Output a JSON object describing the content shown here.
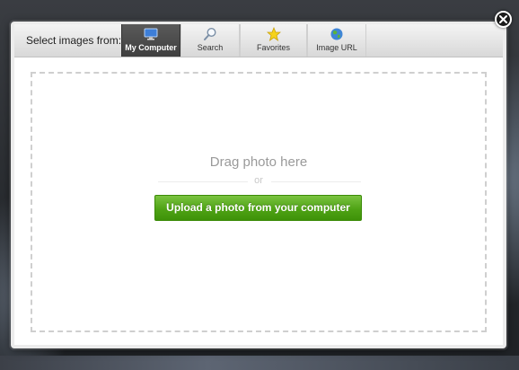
{
  "dialog": {
    "select_label": "Select images from:",
    "tabs": [
      {
        "label": "My Computer",
        "icon": "monitor-icon",
        "active": true
      },
      {
        "label": "Search",
        "icon": "magnifier-icon",
        "active": false
      },
      {
        "label": "Favorites",
        "icon": "star-icon",
        "active": false
      },
      {
        "label": "Image URL",
        "icon": "globe-icon",
        "active": false
      }
    ],
    "drag_text": "Drag photo here",
    "or_text": "or",
    "upload_button": "Upload a photo from your computer",
    "close_icon": "close-icon"
  },
  "colors": {
    "upload_green": "#4fa315",
    "active_tab": "#3f3f3f"
  }
}
